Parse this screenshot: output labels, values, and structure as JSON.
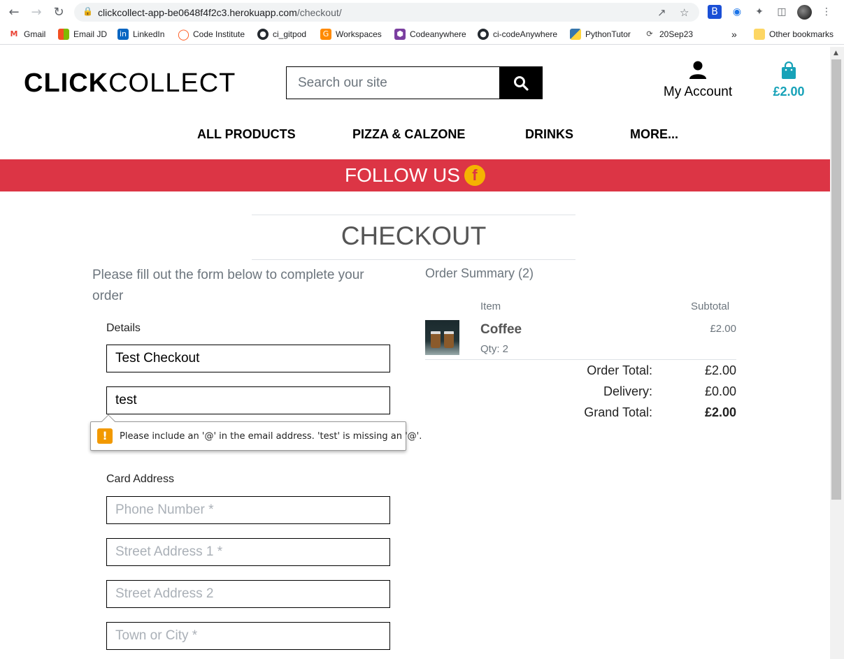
{
  "browser": {
    "url_host": "clickcollect-app-be0648f4f2c3.herokuapp.com",
    "url_path": "/checkout/",
    "bookmarks": [
      {
        "label": "Gmail",
        "icon": "gmail-icon",
        "color": "#ea4335"
      },
      {
        "label": "Email JD",
        "icon": "microsoft-icon",
        "color": "#f25022"
      },
      {
        "label": "LinkedIn",
        "icon": "linkedin-icon",
        "color": "#0a66c2"
      },
      {
        "label": "Code Institute",
        "icon": "code-institute-icon",
        "color": "#ff5a1f"
      },
      {
        "label": "ci_gitpod",
        "icon": "github-icon",
        "color": "#24292f"
      },
      {
        "label": "Workspaces",
        "icon": "gitpod-icon",
        "color": "#ff8a00"
      },
      {
        "label": "Codeanywhere",
        "icon": "codeanywhere-icon",
        "color": "#7b3fa0"
      },
      {
        "label": "ci-codeAnywhere",
        "icon": "github-icon",
        "color": "#24292f"
      },
      {
        "label": "PythonTutor",
        "icon": "python-icon",
        "color": "#3776ab"
      },
      {
        "label": "20Sep23",
        "icon": "spinner-icon",
        "color": "#444444"
      }
    ],
    "overflow_label": "»",
    "other_bookmarks": "Other bookmarks"
  },
  "site": {
    "logo_bold": "CLICK",
    "logo_light": "COLLECT",
    "search_placeholder": "Search our site",
    "account_label": "My Account",
    "bag_total": "£2.00",
    "nav": [
      "ALL PRODUCTS",
      "PIZZA & CALZONE",
      "DRINKS",
      "MORE..."
    ],
    "banner_text": "FOLLOW US",
    "banner_icon_letter": "f",
    "accent_color": "#17a2b8",
    "banner_color": "#dc3545"
  },
  "checkout": {
    "title": "CHECKOUT",
    "intro": "Please fill out the form below to complete your order",
    "details_legend": "Details",
    "full_name_value": "Test Checkout",
    "email_value": "test",
    "validation_message": "Please include an '@' in the email address. 'test' is missing an '@'.",
    "card_address_legend": "Card Address",
    "phone_placeholder": "Phone Number *",
    "street1_placeholder": "Street Address 1 *",
    "street2_placeholder": "Street Address 2",
    "town_placeholder": "Town or City *"
  },
  "summary": {
    "heading": "Order Summary (2)",
    "col_item": "Item",
    "col_subtotal": "Subtotal",
    "item_name": "Coffee",
    "item_qty": "Qty: 2",
    "item_subtotal": "£2.00",
    "order_total_label": "Order Total:",
    "order_total": "£2.00",
    "delivery_label": "Delivery:",
    "delivery": "£0.00",
    "grand_total_label": "Grand Total:",
    "grand_total": "£2.00"
  }
}
